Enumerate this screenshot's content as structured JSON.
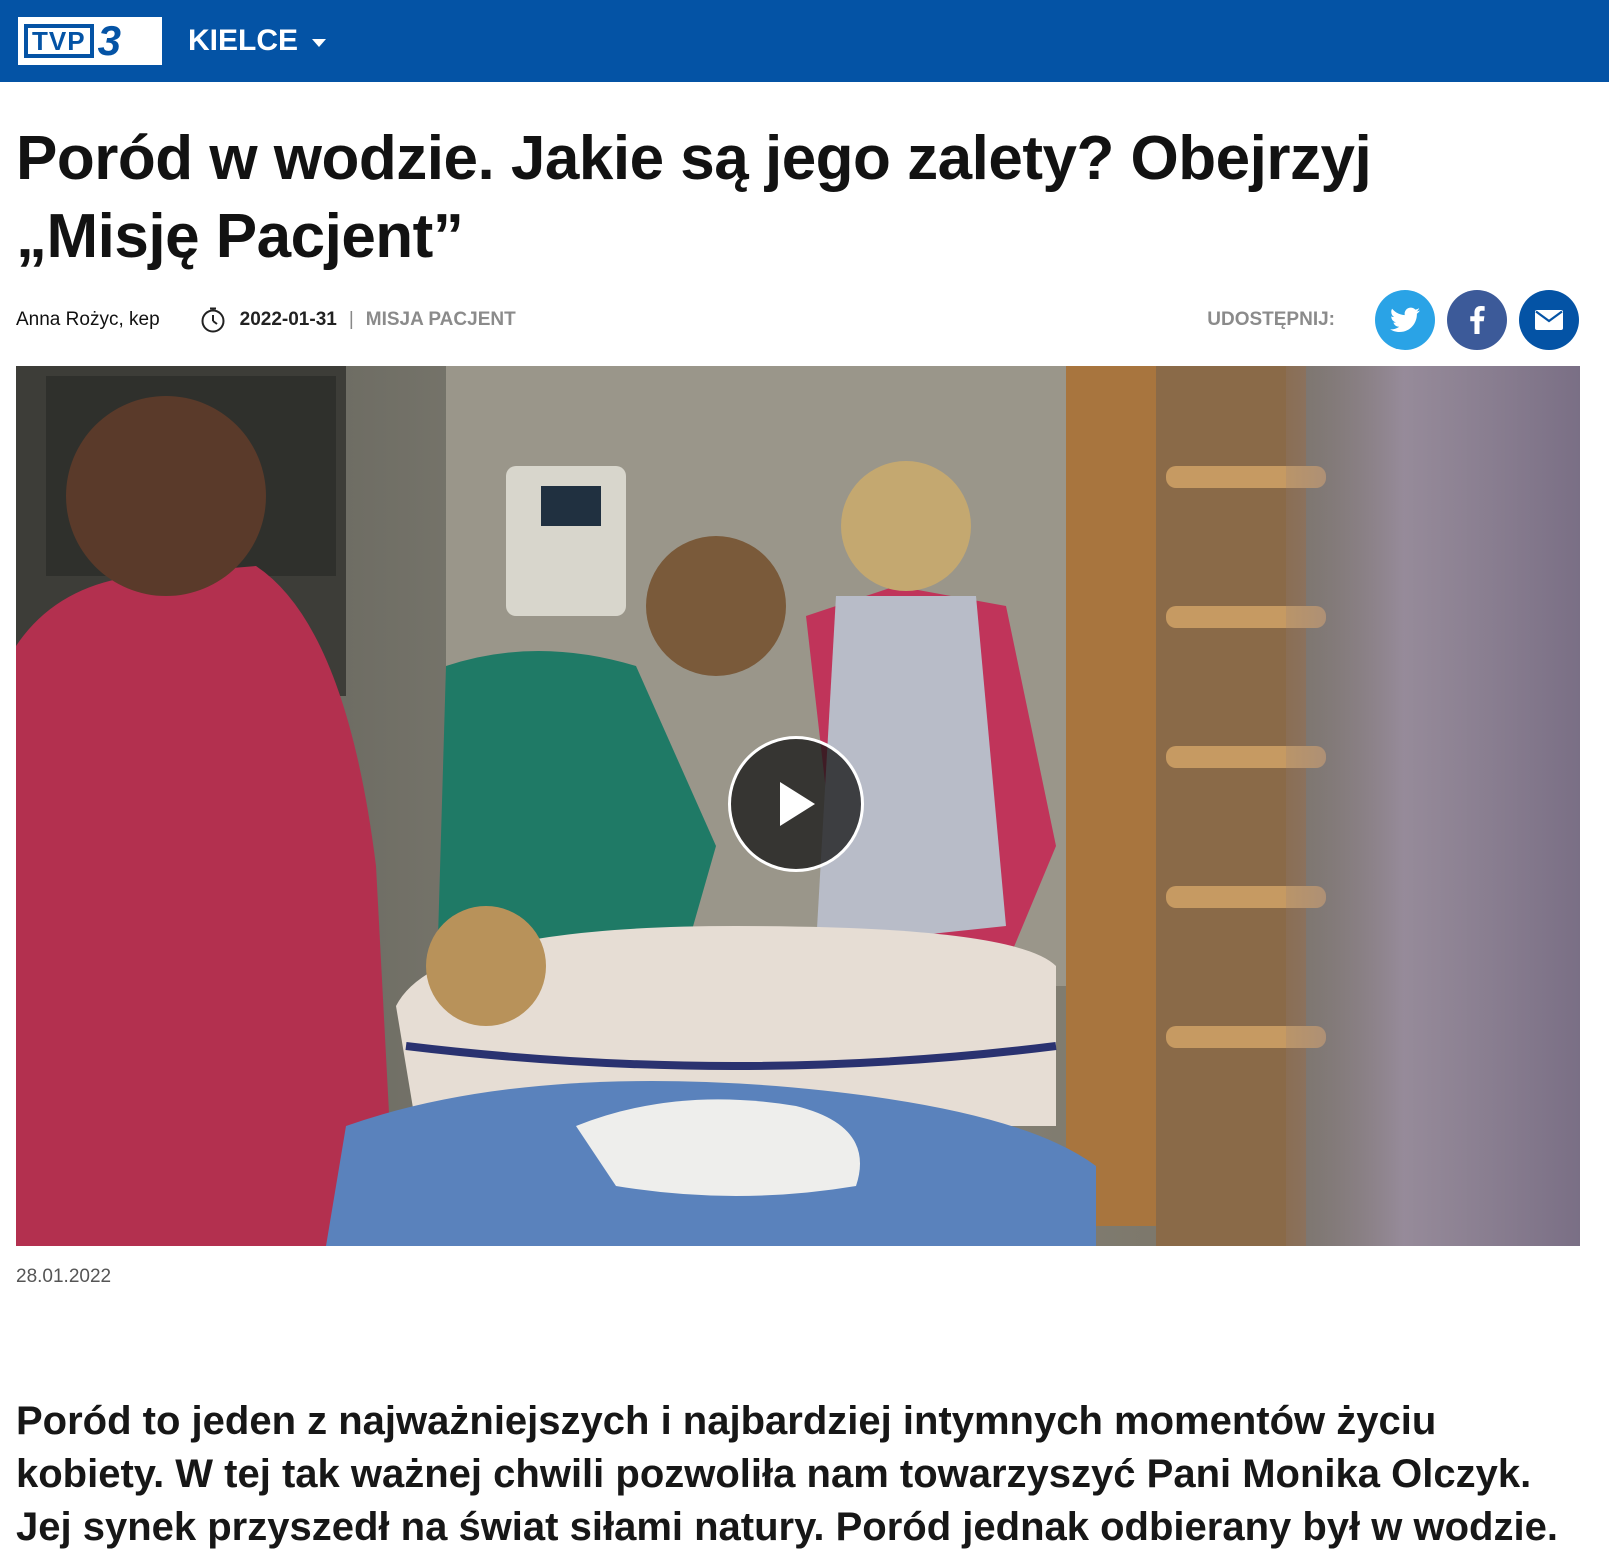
{
  "header": {
    "logo_text": "TVP",
    "logo_number": "3",
    "region_label": "KIELCE",
    "region_icon": "chevron-down-icon",
    "brand_color": "#0453a5"
  },
  "article": {
    "title": "Poród w wodzie. Jakie są jego zalety? Obejrzyj „Misję Pacjent”",
    "author": "Anna Rożyc, kep",
    "date": "2022-01-31",
    "separator": "|",
    "category": "MISJA PACJENT",
    "share_label": "UDOSTĘPNIJ:",
    "share_buttons": [
      {
        "name": "twitter",
        "icon": "twitter-icon",
        "color": "#2aa3e6"
      },
      {
        "name": "facebook",
        "icon": "facebook-icon",
        "color": "#3c5a99"
      },
      {
        "name": "email",
        "icon": "envelope-icon",
        "color": "#0453a5"
      }
    ],
    "video": {
      "play_icon": "play-icon"
    },
    "video_caption_date": "28.01.2022",
    "lead": "Poród to jeden z najważniejszych i najbardziej intymnych momentów życiu kobiety. W tej tak ważnej chwili pozwoliła nam towarzyszyć Pani Monika Olczyk. Jej synek przyszedł na świat siłami natury. Poród jednak odbierany był w wodzie."
  }
}
